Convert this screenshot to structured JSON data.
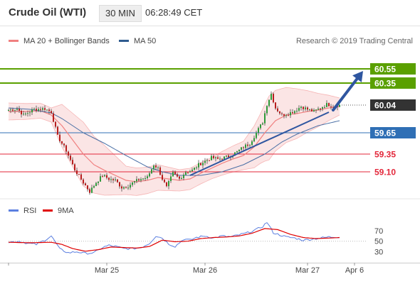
{
  "header": {
    "title": "Crude Oil (WTI)",
    "interval": "30 MIN",
    "time": "06:28:49 CET"
  },
  "legend": {
    "items": [
      {
        "label": "MA 20 + Bollinger Bands",
        "color": "#f08080"
      },
      {
        "label": "MA 50",
        "color": "#2f5b8f"
      }
    ],
    "credit": "Research © 2019 Trading Central"
  },
  "chart_data": [
    {
      "type": "line",
      "title": "Crude Oil (WTI)",
      "subtitle": "30 MIN",
      "x_ticks": [
        "Mar 25",
        "Mar 26",
        "Mar 27",
        "Apr 6"
      ],
      "ylim": [
        58.82,
        60.76
      ],
      "levels": [
        {
          "value": 60.55,
          "label": "60.55",
          "style": "resistance",
          "color": "#5aa000"
        },
        {
          "value": 60.35,
          "label": "60.35",
          "style": "resistance",
          "color": "#5aa000"
        },
        {
          "value": 59.65,
          "label": "59.65",
          "style": "pivot",
          "color": "#2f6fb5"
        },
        {
          "value": 59.35,
          "label": "59.35",
          "style": "support",
          "color": "#e3273a"
        },
        {
          "value": 59.1,
          "label": "59.10",
          "style": "support",
          "color": "#e3273a"
        }
      ],
      "last_price": {
        "value": 60.04,
        "label": "60.04"
      },
      "anchors": [
        [
          0,
          59.97
        ],
        [
          4,
          59.99
        ],
        [
          7,
          59.9
        ],
        [
          12,
          59.98
        ],
        [
          17,
          59.99
        ],
        [
          20,
          59.94
        ],
        [
          23,
          59.6
        ],
        [
          27,
          59.4
        ],
        [
          31,
          59.13
        ],
        [
          35,
          58.95
        ],
        [
          38,
          58.82
        ],
        [
          41,
          58.95
        ],
        [
          44,
          59.05
        ],
        [
          47,
          59.0
        ],
        [
          50,
          58.98
        ],
        [
          53,
          58.88
        ],
        [
          56,
          58.9
        ],
        [
          59,
          58.96
        ],
        [
          62,
          59.0
        ],
        [
          65,
          59.02
        ],
        [
          68,
          59.2
        ],
        [
          70,
          59.15
        ],
        [
          72,
          59.0
        ],
        [
          74,
          58.88
        ],
        [
          77,
          59.08
        ],
        [
          80,
          59.0
        ],
        [
          83,
          59.1
        ],
        [
          86,
          59.12
        ],
        [
          89,
          59.2
        ],
        [
          92,
          59.25
        ],
        [
          95,
          59.3
        ],
        [
          98,
          59.28
        ],
        [
          101,
          59.3
        ],
        [
          104,
          59.33
        ],
        [
          107,
          59.38
        ],
        [
          110,
          59.45
        ],
        [
          113,
          59.5
        ],
        [
          116,
          59.65
        ],
        [
          119,
          59.8
        ],
        [
          121,
          60.05
        ],
        [
          123,
          60.2
        ],
        [
          125,
          60.0
        ],
        [
          128,
          59.9
        ],
        [
          131,
          59.92
        ],
        [
          134,
          59.96
        ],
        [
          137,
          60.02
        ],
        [
          140,
          59.98
        ],
        [
          143,
          59.95
        ],
        [
          146,
          60.0
        ],
        [
          149,
          60.05
        ],
        [
          152,
          60.03
        ],
        [
          155,
          60.04
        ]
      ],
      "ma20": [
        [
          0,
          59.95
        ],
        [
          8,
          59.95
        ],
        [
          15,
          59.96
        ],
        [
          20,
          59.9
        ],
        [
          25,
          59.75
        ],
        [
          30,
          59.55
        ],
        [
          35,
          59.35
        ],
        [
          40,
          59.2
        ],
        [
          45,
          59.12
        ],
        [
          50,
          59.05
        ],
        [
          55,
          58.98
        ],
        [
          60,
          58.96
        ],
        [
          65,
          58.98
        ],
        [
          70,
          59.02
        ],
        [
          75,
          59.0
        ],
        [
          80,
          58.98
        ],
        [
          85,
          59.0
        ],
        [
          90,
          59.08
        ],
        [
          95,
          59.15
        ],
        [
          100,
          59.22
        ],
        [
          105,
          59.28
        ],
        [
          110,
          59.33
        ],
        [
          115,
          59.45
        ],
        [
          120,
          59.65
        ],
        [
          125,
          59.82
        ],
        [
          130,
          59.9
        ],
        [
          135,
          59.92
        ],
        [
          140,
          59.95
        ],
        [
          145,
          59.97
        ],
        [
          150,
          60.0
        ],
        [
          155,
          60.02
        ]
      ],
      "bb_width": [
        [
          0,
          0.12
        ],
        [
          20,
          0.1
        ],
        [
          25,
          0.3
        ],
        [
          35,
          0.45
        ],
        [
          45,
          0.35
        ],
        [
          55,
          0.2
        ],
        [
          70,
          0.18
        ],
        [
          80,
          0.15
        ],
        [
          95,
          0.15
        ],
        [
          110,
          0.2
        ],
        [
          118,
          0.35
        ],
        [
          122,
          0.45
        ],
        [
          135,
          0.35
        ],
        [
          155,
          0.12
        ]
      ],
      "ma50": [
        [
          0,
          60.0
        ],
        [
          10,
          59.98
        ],
        [
          20,
          59.93
        ],
        [
          25,
          59.85
        ],
        [
          35,
          59.65
        ],
        [
          45,
          59.5
        ],
        [
          55,
          59.33
        ],
        [
          65,
          59.17
        ],
        [
          72,
          59.1
        ],
        [
          80,
          59.05
        ],
        [
          90,
          59.05
        ],
        [
          100,
          59.1
        ],
        [
          110,
          59.2
        ],
        [
          120,
          59.35
        ],
        [
          128,
          59.52
        ],
        [
          135,
          59.63
        ],
        [
          145,
          59.75
        ],
        [
          155,
          59.82
        ]
      ],
      "trendline": [
        [
          85,
          59.05
        ],
        [
          150,
          59.94
        ]
      ],
      "forecast_arrow": [
        [
          152,
          59.97
        ],
        [
          166,
          60.52
        ]
      ]
    },
    {
      "type": "line",
      "series": [
        {
          "name": "RSI",
          "color": "#5b7fe0"
        },
        {
          "name": "9MA",
          "color": "#e00000"
        }
      ],
      "ylim": [
        20,
        90
      ],
      "y_ticks": [
        "70",
        "50",
        "30"
      ],
      "rsi": [
        [
          0,
          48
        ],
        [
          5,
          50
        ],
        [
          9,
          46
        ],
        [
          13,
          44
        ],
        [
          17,
          52
        ],
        [
          20,
          60
        ],
        [
          24,
          35
        ],
        [
          28,
          28
        ],
        [
          32,
          30
        ],
        [
          36,
          27
        ],
        [
          40,
          28
        ],
        [
          44,
          38
        ],
        [
          47,
          42
        ],
        [
          50,
          40
        ],
        [
          54,
          36
        ],
        [
          58,
          36
        ],
        [
          62,
          38
        ],
        [
          66,
          46
        ],
        [
          69,
          60
        ],
        [
          72,
          56
        ],
        [
          75,
          45
        ],
        [
          78,
          40
        ],
        [
          82,
          54
        ],
        [
          85,
          52
        ],
        [
          88,
          57
        ],
        [
          92,
          60
        ],
        [
          96,
          56
        ],
        [
          100,
          60
        ],
        [
          104,
          58
        ],
        [
          108,
          62
        ],
        [
          112,
          66
        ],
        [
          116,
          72
        ],
        [
          119,
          78
        ],
        [
          121,
          86
        ],
        [
          124,
          66
        ],
        [
          127,
          62
        ],
        [
          130,
          58
        ],
        [
          134,
          56
        ],
        [
          138,
          52
        ],
        [
          142,
          54
        ],
        [
          146,
          56
        ],
        [
          150,
          58
        ],
        [
          155,
          58
        ]
      ],
      "ma9": [
        [
          0,
          48
        ],
        [
          10,
          47
        ],
        [
          20,
          48
        ],
        [
          25,
          44
        ],
        [
          30,
          36
        ],
        [
          36,
          31
        ],
        [
          42,
          34
        ],
        [
          48,
          39
        ],
        [
          54,
          38
        ],
        [
          60,
          37
        ],
        [
          66,
          40
        ],
        [
          72,
          52
        ],
        [
          78,
          49
        ],
        [
          84,
          50
        ],
        [
          90,
          55
        ],
        [
          96,
          57
        ],
        [
          102,
          58
        ],
        [
          108,
          60
        ],
        [
          114,
          65
        ],
        [
          120,
          74
        ],
        [
          126,
          72
        ],
        [
          132,
          63
        ],
        [
          138,
          57
        ],
        [
          144,
          55
        ],
        [
          150,
          56
        ],
        [
          155,
          57
        ]
      ]
    }
  ]
}
